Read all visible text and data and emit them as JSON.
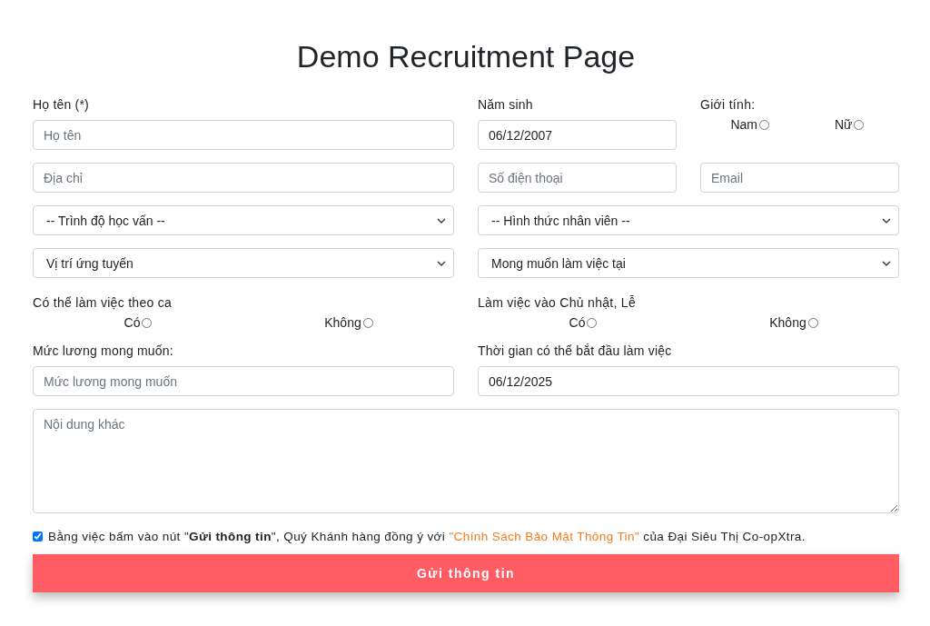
{
  "title": "Demo Recruitment Page",
  "full_name": {
    "label": "Họ tên (*)",
    "placeholder": "Họ tên"
  },
  "birth_year": {
    "label": "Năm sinh",
    "value": "06/12/2007"
  },
  "gender": {
    "label": "Giới tính:",
    "options": [
      {
        "label": "Nam",
        "selected": false
      },
      {
        "label": "Nữ",
        "selected": false
      }
    ]
  },
  "address": {
    "placeholder": "Địa chỉ"
  },
  "phone": {
    "placeholder": "Số điện thoại"
  },
  "email": {
    "placeholder": "Email"
  },
  "education": {
    "value": "-- Trình độ học vấn --"
  },
  "employment_type": {
    "value": "-- Hình thức nhân viên --"
  },
  "position": {
    "value": "Vị trí ứng tuyển"
  },
  "work_location": {
    "value": "Mong muốn làm việc tại"
  },
  "shift_work": {
    "label": "Có thể làm việc theo ca",
    "options": [
      {
        "label": "Có",
        "selected": false
      },
      {
        "label": "Không",
        "selected": false
      }
    ]
  },
  "holiday_work": {
    "label": "Làm việc vào Chủ nhật, Lễ",
    "options": [
      {
        "label": "Có",
        "selected": false
      },
      {
        "label": "Không",
        "selected": false
      }
    ]
  },
  "salary": {
    "label": "Mức lương mong muốn:",
    "placeholder": "Mức lương mong muốn"
  },
  "start_date": {
    "label": "Thời gian có thể bắt đầu làm việc",
    "value": "06/12/2025"
  },
  "other": {
    "placeholder": "Nội dung khác"
  },
  "consent": {
    "checked": true,
    "text_before": "Bằng việc bấm vào nút \"**Gửi thông tin**\", Quý Khánh hàng đồng ý với ",
    "link": "\"Chính Sách Bảo Mật Thông Tin\"",
    "text_after": " của Đại Siêu Thị Co-opXtra."
  },
  "submit_button": "Gửi thông tin"
}
